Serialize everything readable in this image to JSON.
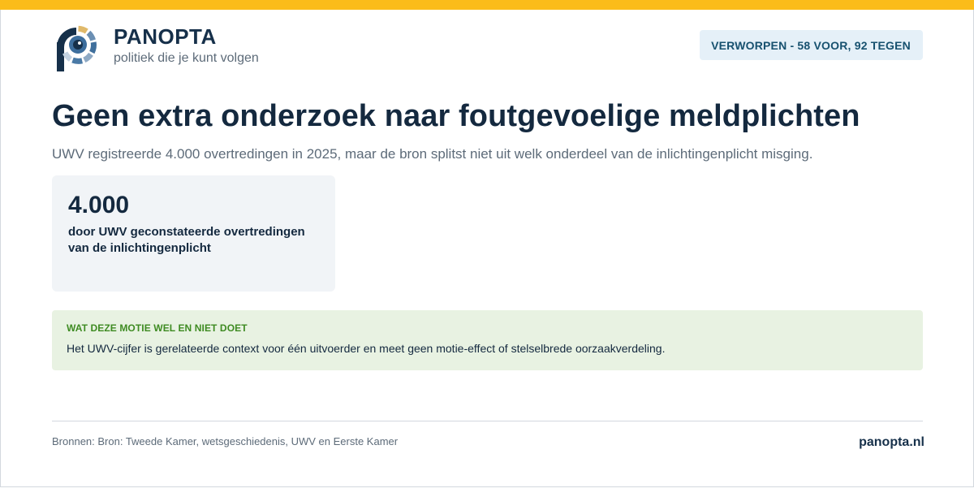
{
  "colors": {
    "accent_bar": "#fbbc1a",
    "primary_text": "#14293f",
    "muted_text": "#5d6b79",
    "badge_bg": "#e5f0f8",
    "badge_text": "#17516f",
    "stat_bg": "#f1f4f7",
    "note_bg": "#e8f2e2",
    "note_title": "#3e8b22"
  },
  "brand": {
    "logo_icon": "panopta-eye-logo-icon",
    "name": "PANOPTA",
    "tagline": "politiek die je kunt volgen"
  },
  "status_badge": "VERWORPEN - 58 VOOR, 92 TEGEN",
  "headline": "Geen extra onderzoek naar foutgevoelige meldplichten",
  "subheadline": "UWV registreerde 4.000 overtredingen in 2025, maar de bron splitst niet uit welk onderdeel van de inlichtingenplicht misging.",
  "stat": {
    "value": "4.000",
    "label": "door UWV geconstateerde overtredingen van de inlichtingenplicht"
  },
  "note": {
    "title": "WAT DEZE MOTIE WEL EN NIET DOET",
    "text": "Het UWV-cijfer is gerelateerde context voor één uitvoerder en meet geen motie-effect of stelselbrede oorzaakverdeling."
  },
  "footer": {
    "sources": "Bronnen: Bron: Tweede Kamer, wetsgeschiedenis, UWV en Eerste Kamer",
    "site": "panopta.nl"
  }
}
